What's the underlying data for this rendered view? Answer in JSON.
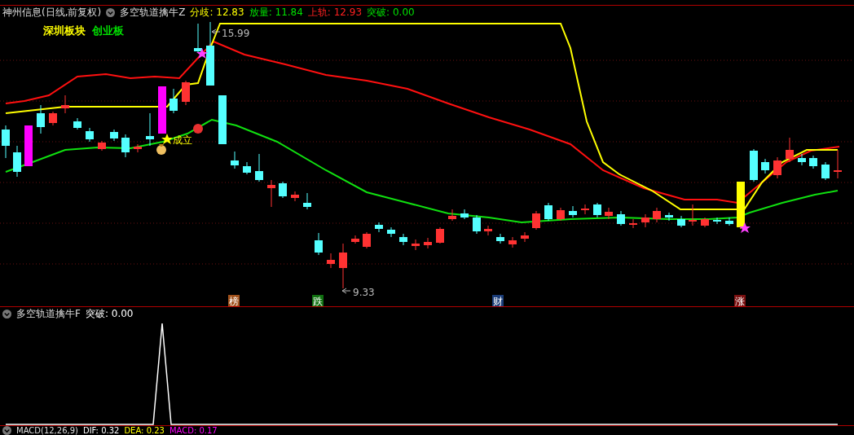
{
  "header": {
    "stock": "神州信息(日线,前复权)",
    "indicator": "多空轨道擒牛Z",
    "readings": [
      {
        "text": "分歧: 12.83",
        "color": "#ffff00"
      },
      {
        "text": "放量: 11.84",
        "color": "#00e000"
      },
      {
        "text": "上轨: 12.93",
        "color": "#ff2020"
      },
      {
        "text": "突破: 0.00",
        "color": "#00e000"
      }
    ]
  },
  "main_chart": {
    "sector_tags": [
      {
        "text": "深圳板块",
        "color": "#ffff00"
      },
      {
        "text": "创业板",
        "color": "#00e000"
      }
    ],
    "high_label": "15.99",
    "low_label": "9.33",
    "signal_label": "成立",
    "event_markers": [
      {
        "text": "榜",
        "color": "#a0501a"
      },
      {
        "text": "跌",
        "color": "#107010"
      },
      {
        "text": "财",
        "color": "#1a3c78"
      },
      {
        "text": "涨",
        "color": "#7a1010"
      }
    ]
  },
  "sub_chart": {
    "indicator": "多空轨道擒牛F",
    "readings": [
      {
        "text": "突破: 0.00",
        "color": "#ffffff"
      }
    ]
  },
  "macd": {
    "title": "MACD(12,26,9)",
    "readings": [
      {
        "text": "DIF: 0.32",
        "color": "#ffffff"
      },
      {
        "text": "DEA: 0.23",
        "color": "#ffff00"
      },
      {
        "text": "MACD: 0.17",
        "color": "#ff00ff"
      }
    ]
  }
}
